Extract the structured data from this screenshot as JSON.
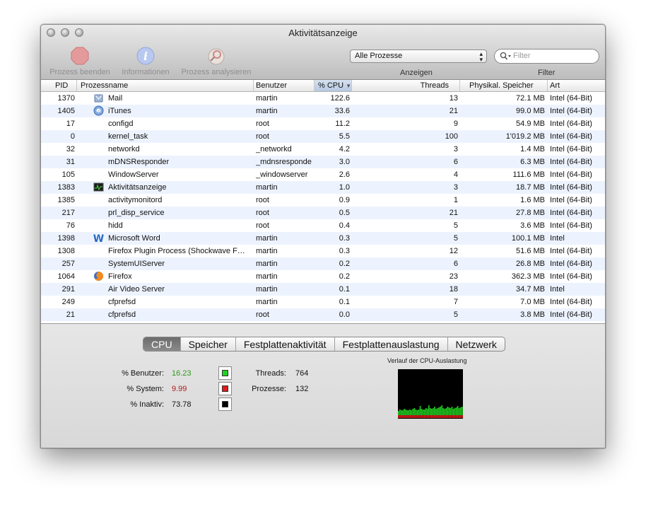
{
  "window": {
    "title": "Aktivitätsanzeige"
  },
  "toolbar": {
    "quit_label": "Prozess beenden",
    "info_label": "Informationen",
    "inspect_label": "Prozess analysieren",
    "show_select": "Alle Prozesse",
    "show_caption": "Anzeigen",
    "filter_placeholder": "Filter",
    "filter_caption": "Filter"
  },
  "table": {
    "headers": {
      "pid": "PID",
      "name": "Prozessname",
      "user": "Benutzer",
      "cpu": "% CPU",
      "threads": "Threads",
      "memory": "Physikal. Speicher",
      "kind": "Art"
    },
    "rows": [
      {
        "pid": "1370",
        "name": "Mail",
        "user": "martin",
        "cpu": "122.6",
        "threads": "13",
        "memory": "72.1 MB",
        "kind": "Intel (64-Bit)",
        "icon": "mail-icon"
      },
      {
        "pid": "1405",
        "name": "iTunes",
        "user": "martin",
        "cpu": "33.6",
        "threads": "21",
        "memory": "99.0 MB",
        "kind": "Intel (64-Bit)",
        "icon": "itunes-icon"
      },
      {
        "pid": "17",
        "name": "configd",
        "user": "root",
        "cpu": "11.2",
        "threads": "9",
        "memory": "54.9 MB",
        "kind": "Intel (64-Bit)",
        "icon": ""
      },
      {
        "pid": "0",
        "name": "kernel_task",
        "user": "root",
        "cpu": "5.5",
        "threads": "100",
        "memory": "1'019.2 MB",
        "kind": "Intel (64-Bit)",
        "icon": ""
      },
      {
        "pid": "32",
        "name": "networkd",
        "user": "_networkd",
        "cpu": "4.2",
        "threads": "3",
        "memory": "1.4 MB",
        "kind": "Intel (64-Bit)",
        "icon": ""
      },
      {
        "pid": "31",
        "name": "mDNSResponder",
        "user": "_mdnsresponde",
        "cpu": "3.0",
        "threads": "6",
        "memory": "6.3 MB",
        "kind": "Intel (64-Bit)",
        "icon": ""
      },
      {
        "pid": "105",
        "name": "WindowServer",
        "user": "_windowserver",
        "cpu": "2.6",
        "threads": "4",
        "memory": "111.6 MB",
        "kind": "Intel (64-Bit)",
        "icon": ""
      },
      {
        "pid": "1383",
        "name": "Aktivitätsanzeige",
        "user": "martin",
        "cpu": "1.0",
        "threads": "3",
        "memory": "18.7 MB",
        "kind": "Intel (64-Bit)",
        "icon": "activity-monitor-icon"
      },
      {
        "pid": "1385",
        "name": "activitymonitord",
        "user": "root",
        "cpu": "0.9",
        "threads": "1",
        "memory": "1.6 MB",
        "kind": "Intel (64-Bit)",
        "icon": ""
      },
      {
        "pid": "217",
        "name": "prl_disp_service",
        "user": "root",
        "cpu": "0.5",
        "threads": "21",
        "memory": "27.8 MB",
        "kind": "Intel (64-Bit)",
        "icon": ""
      },
      {
        "pid": "76",
        "name": "hidd",
        "user": "root",
        "cpu": "0.4",
        "threads": "5",
        "memory": "3.6 MB",
        "kind": "Intel (64-Bit)",
        "icon": ""
      },
      {
        "pid": "1398",
        "name": "Microsoft Word",
        "user": "martin",
        "cpu": "0.3",
        "threads": "5",
        "memory": "100.1 MB",
        "kind": "Intel",
        "icon": "word-icon"
      },
      {
        "pid": "1308",
        "name": "Firefox Plugin Process (Shockwave F…",
        "user": "martin",
        "cpu": "0.3",
        "threads": "12",
        "memory": "51.6 MB",
        "kind": "Intel (64-Bit)",
        "icon": ""
      },
      {
        "pid": "257",
        "name": "SystemUIServer",
        "user": "martin",
        "cpu": "0.2",
        "threads": "6",
        "memory": "26.8 MB",
        "kind": "Intel (64-Bit)",
        "icon": ""
      },
      {
        "pid": "1064",
        "name": "Firefox",
        "user": "martin",
        "cpu": "0.2",
        "threads": "23",
        "memory": "362.3 MB",
        "kind": "Intel (64-Bit)",
        "icon": "firefox-icon"
      },
      {
        "pid": "291",
        "name": "Air Video Server",
        "user": "martin",
        "cpu": "0.1",
        "threads": "18",
        "memory": "34.7 MB",
        "kind": "Intel",
        "icon": ""
      },
      {
        "pid": "249",
        "name": "cfprefsd",
        "user": "martin",
        "cpu": "0.1",
        "threads": "7",
        "memory": "7.0 MB",
        "kind": "Intel (64-Bit)",
        "icon": ""
      },
      {
        "pid": "21",
        "name": "cfprefsd",
        "user": "root",
        "cpu": "0.0",
        "threads": "5",
        "memory": "3.8 MB",
        "kind": "Intel (64-Bit)",
        "icon": ""
      }
    ]
  },
  "tabs": [
    "CPU",
    "Speicher",
    "Festplattenaktivität",
    "Festplattenauslastung",
    "Netzwerk"
  ],
  "active_tab": "CPU",
  "stats": {
    "user_label": "% Benutzer:",
    "user_value": "16.23",
    "system_label": "% System:",
    "system_value": "9.99",
    "idle_label": "% Inaktiv:",
    "idle_value": "73.78",
    "threads_label": "Threads:",
    "threads_value": "764",
    "processes_label": "Prozesse:",
    "processes_value": "132"
  },
  "colors": {
    "user": "#22d022",
    "system": "#e01c1c",
    "idle": "#000000",
    "user_text": "#2f9a1a",
    "system_text": "#b01818"
  },
  "graph": {
    "title": "Verlauf der CPU-Auslastung"
  }
}
